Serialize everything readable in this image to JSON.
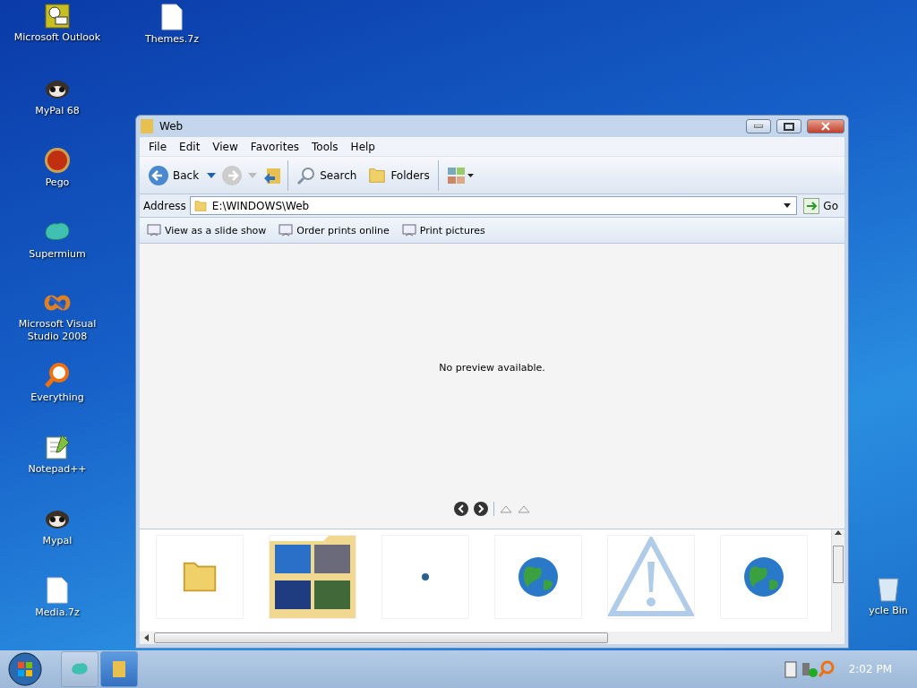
{
  "desktop_icons": [
    {
      "label": "Microsoft Outlook",
      "kind": "outlook"
    },
    {
      "label": "Themes.7z",
      "kind": "file"
    },
    {
      "label": "MyPal 68",
      "kind": "raccoon"
    },
    {
      "label": "Pego",
      "kind": "pego"
    },
    {
      "label": "Supermium",
      "kind": "supermium"
    },
    {
      "label": "Microsoft Visual Studio 2008",
      "kind": "studio"
    },
    {
      "label": "Everything",
      "kind": "search"
    },
    {
      "label": "Notepad++",
      "kind": "notepad"
    },
    {
      "label": "Mypal",
      "kind": "raccoon"
    },
    {
      "label": "Media.7z",
      "kind": "file"
    },
    {
      "label": "ycle Bin",
      "kind": "bin"
    }
  ],
  "window": {
    "title": "Web",
    "menu": [
      "File",
      "Edit",
      "View",
      "Favorites",
      "Tools",
      "Help"
    ],
    "toolbar": {
      "back": "Back",
      "search": "Search",
      "folders": "Folders"
    },
    "address": {
      "label": "Address",
      "value": "E:\\WINDOWS\\Web",
      "go": "Go"
    },
    "tasks": [
      "View as a slide show",
      "Order prints online",
      "Print pictures"
    ],
    "preview": {
      "message": "No preview available."
    },
    "thumbnails": [
      {
        "kind": "folder"
      },
      {
        "kind": "pictures"
      },
      {
        "kind": "dot"
      },
      {
        "kind": "globe"
      },
      {
        "kind": "warning"
      },
      {
        "kind": "globe"
      }
    ]
  },
  "taskbar": {
    "items": [
      {
        "kind": "supermium",
        "selected": false
      },
      {
        "kind": "explorer",
        "selected": true
      }
    ],
    "clock": "2:02 PM"
  }
}
